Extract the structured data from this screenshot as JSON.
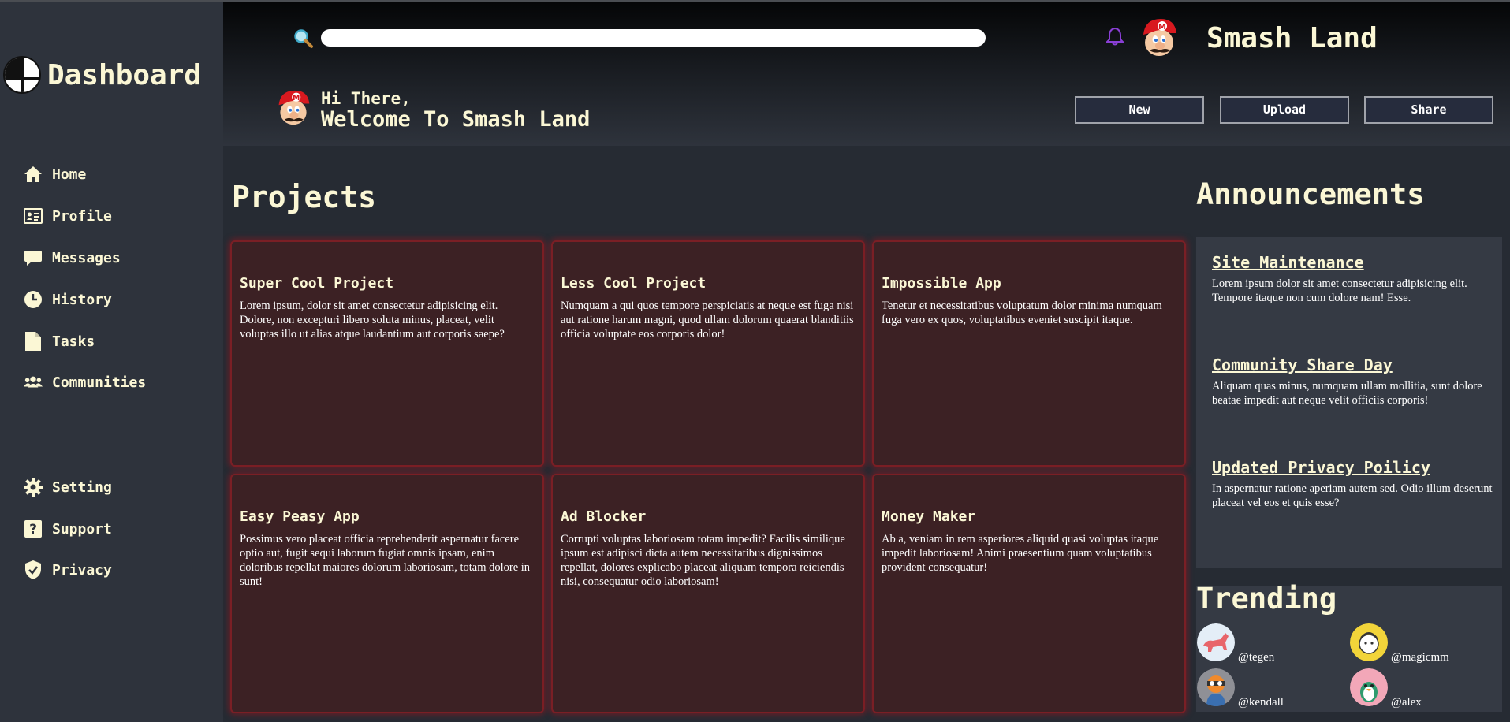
{
  "sidebar": {
    "title": "Dashboard",
    "items": [
      {
        "label": "Home",
        "icon": "home-icon"
      },
      {
        "label": "Profile",
        "icon": "id-card-icon"
      },
      {
        "label": "Messages",
        "icon": "message-icon"
      },
      {
        "label": "History",
        "icon": "clock-icon"
      },
      {
        "label": "Tasks",
        "icon": "document-icon"
      },
      {
        "label": "Communities",
        "icon": "users-icon"
      }
    ],
    "bottom_items": [
      {
        "label": "Setting",
        "icon": "gear-icon"
      },
      {
        "label": "Support",
        "icon": "question-icon"
      },
      {
        "label": "Privacy",
        "icon": "shield-icon"
      }
    ]
  },
  "header": {
    "search": {
      "placeholder": "",
      "value": ""
    },
    "site_name": "Smash Land",
    "greeting_line1": "Hi There,",
    "greeting_line2": "Welcome To Smash Land",
    "buttons": {
      "new": "New",
      "upload": "Upload",
      "share": "Share"
    }
  },
  "projects": {
    "title": "Projects",
    "cards": [
      {
        "title": "Super Cool Project",
        "body": "Lorem ipsum, dolor sit amet consectetur adipisicing elit. Dolore, non excepturi libero soluta minus, placeat, velit voluptas illo ut alias atque laudantium aut corporis saepe?"
      },
      {
        "title": "Less Cool Project",
        "body": "Numquam a qui quos tempore perspiciatis at neque est fuga nisi aut ratione harum magni, quod ullam dolorum quaerat blanditiis officia voluptate eos corporis dolor!"
      },
      {
        "title": "Impossible App",
        "body": "Tenetur et necessitatibus voluptatum dolor minima numquam fuga vero ex quos, voluptatibus eveniet suscipit itaque."
      },
      {
        "title": "Easy Peasy App",
        "body": "Possimus vero placeat officia reprehenderit aspernatur facere optio aut, fugit sequi laborum fugiat omnis ipsam, enim doloribus repellat maiores dolorum laboriosam, totam dolore in sunt!"
      },
      {
        "title": "Ad Blocker",
        "body": "Corrupti voluptas laboriosam totam impedit? Facilis similique ipsum est adipisci dicta autem necessitatibus dignissimos repellat, dolores explicabo placeat aliquam tempora reiciendis nisi, consequatur odio laboriosam!"
      },
      {
        "title": "Money Maker",
        "body": "Ab a, veniam in rem asperiores aliquid quasi voluptas itaque impedit laboriosam! Animi praesentium quam voluptatibus provident consequatur!"
      }
    ]
  },
  "announcements": {
    "title": "Announcements",
    "items": [
      {
        "title": "Site Maintenance",
        "body": "Lorem ipsum dolor sit amet consectetur adipisicing elit. Tempore itaque non cum dolore nam! Esse."
      },
      {
        "title": "Community Share Day",
        "body": "Aliquam quas minus, numquam ullam mollitia, sunt dolore beatae impedit aut neque velit officiis corporis!"
      },
      {
        "title": "Updated Privacy Poilicy",
        "body": "In aspernatur ratione aperiam autem sed. Odio illum deserunt placeat vel eos et quis esse?"
      }
    ]
  },
  "trending": {
    "title": "Trending",
    "users": [
      {
        "handle": "@tegen"
      },
      {
        "handle": "@magicmm"
      },
      {
        "handle": "@kendall"
      },
      {
        "handle": "@alex"
      }
    ]
  },
  "colors": {
    "accent_text": "#fbf7d5",
    "card_bg": "#3c2124",
    "card_border": "#7a1f25",
    "bell": "#8a3fd6"
  }
}
